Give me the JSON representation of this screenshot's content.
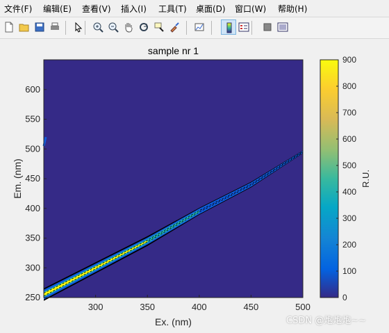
{
  "menu": [
    {
      "label": "文件(F)",
      "icon": "menu-file"
    },
    {
      "label": "编辑(E)",
      "icon": "menu-edit"
    },
    {
      "label": "查看(V)",
      "icon": "menu-view"
    },
    {
      "label": "插入(I)",
      "icon": "menu-insert"
    },
    {
      "label": "工具(T)",
      "icon": "menu-tools"
    },
    {
      "label": "桌面(D)",
      "icon": "menu-desktop"
    },
    {
      "label": "窗口(W)",
      "icon": "menu-window"
    },
    {
      "label": "帮助(H)",
      "icon": "menu-help"
    }
  ],
  "toolbar_icons": [
    "new-figure-icon",
    "open-file-icon",
    "save-icon",
    "print-icon",
    "select-arrow-icon",
    "zoom-in-icon",
    "zoom-out-icon",
    "pan-hand-icon",
    "rotate-3d-icon",
    "data-cursor-icon",
    "brush-icon",
    "link-plot-icon",
    "insert-colorbar-icon",
    "insert-legend-icon",
    "hide-plot-tools-icon",
    "show-plot-tools-icon"
  ],
  "chart_data": {
    "type": "heatmap",
    "title": "sample nr 1",
    "xlabel": "Ex. (nm)",
    "ylabel": "Em. (nm)",
    "xlim": [
      250,
      500
    ],
    "ylim": [
      250,
      650
    ],
    "xticks": [
      "300",
      "350",
      "400",
      "450",
      "500"
    ],
    "yticks": [
      "250",
      "300",
      "350",
      "400",
      "450",
      "500",
      "550",
      "600"
    ],
    "colorbar": {
      "label": "R.U.",
      "range": [
        0,
        900
      ],
      "ticks": [
        "0",
        "100",
        "200",
        "300",
        "400",
        "500",
        "600",
        "700",
        "800",
        "900"
      ]
    },
    "background_value": 0,
    "features": [
      {
        "name": "main-scatter-band",
        "x": [
          250,
          300,
          350,
          400,
          450,
          500
        ],
        "y": [
          255,
          300,
          345,
          395,
          440,
          495
        ]
      },
      {
        "name": "second-order-fragment",
        "x": [
          250,
          252
        ],
        "y": [
          505,
          520
        ]
      }
    ]
  },
  "watermark": "CSDN @炮炮炮~~",
  "colors": {
    "background": "#352a87",
    "high": "#f9fb0e",
    "mid": "#21b3b5",
    "low": "#0f5cdd"
  }
}
